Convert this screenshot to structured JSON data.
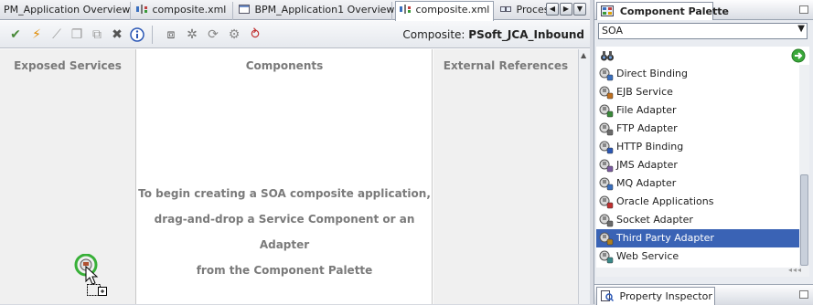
{
  "editor_tabs": [
    {
      "label": "PM_Application Overview",
      "active": false
    },
    {
      "label": "composite.xml",
      "active": false
    },
    {
      "label": "BPM_Application1 Overview",
      "active": false
    },
    {
      "label": "composite.xml",
      "active": true
    },
    {
      "label": "Proces",
      "active": false
    }
  ],
  "toolbar": {
    "composite_label": "Composite:",
    "composite_name": "PSoft_JCA_Inbound"
  },
  "columns": {
    "exposed_services": "Exposed Services",
    "components": "Components",
    "external_references": "External References"
  },
  "hint_lines": [
    "To begin creating a SOA composite application,",
    "drag-and-drop a Service Component or an Adapter",
    "from the Component Palette"
  ],
  "palette": {
    "title": "Component Palette",
    "selected_category": "SOA",
    "items": [
      {
        "label": "Direct Binding",
        "icon": "direct-binding-icon"
      },
      {
        "label": "EJB Service",
        "icon": "ejb-service-icon"
      },
      {
        "label": "File Adapter",
        "icon": "file-adapter-icon"
      },
      {
        "label": "FTP Adapter",
        "icon": "ftp-adapter-icon"
      },
      {
        "label": "HTTP Binding",
        "icon": "http-binding-icon"
      },
      {
        "label": "JMS Adapter",
        "icon": "jms-adapter-icon"
      },
      {
        "label": "MQ Adapter",
        "icon": "mq-adapter-icon"
      },
      {
        "label": "Oracle Applications",
        "icon": "oracle-applications-icon"
      },
      {
        "label": "Socket Adapter",
        "icon": "socket-adapter-icon"
      },
      {
        "label": "Third Party Adapter",
        "icon": "third-party-adapter-icon",
        "selected": true
      },
      {
        "label": "Web Service",
        "icon": "web-service-icon"
      }
    ]
  },
  "property_inspector": {
    "title": "Property Inspector"
  },
  "colors": {
    "selection": "#3a63b5",
    "hint_text": "#7a7a7a"
  }
}
